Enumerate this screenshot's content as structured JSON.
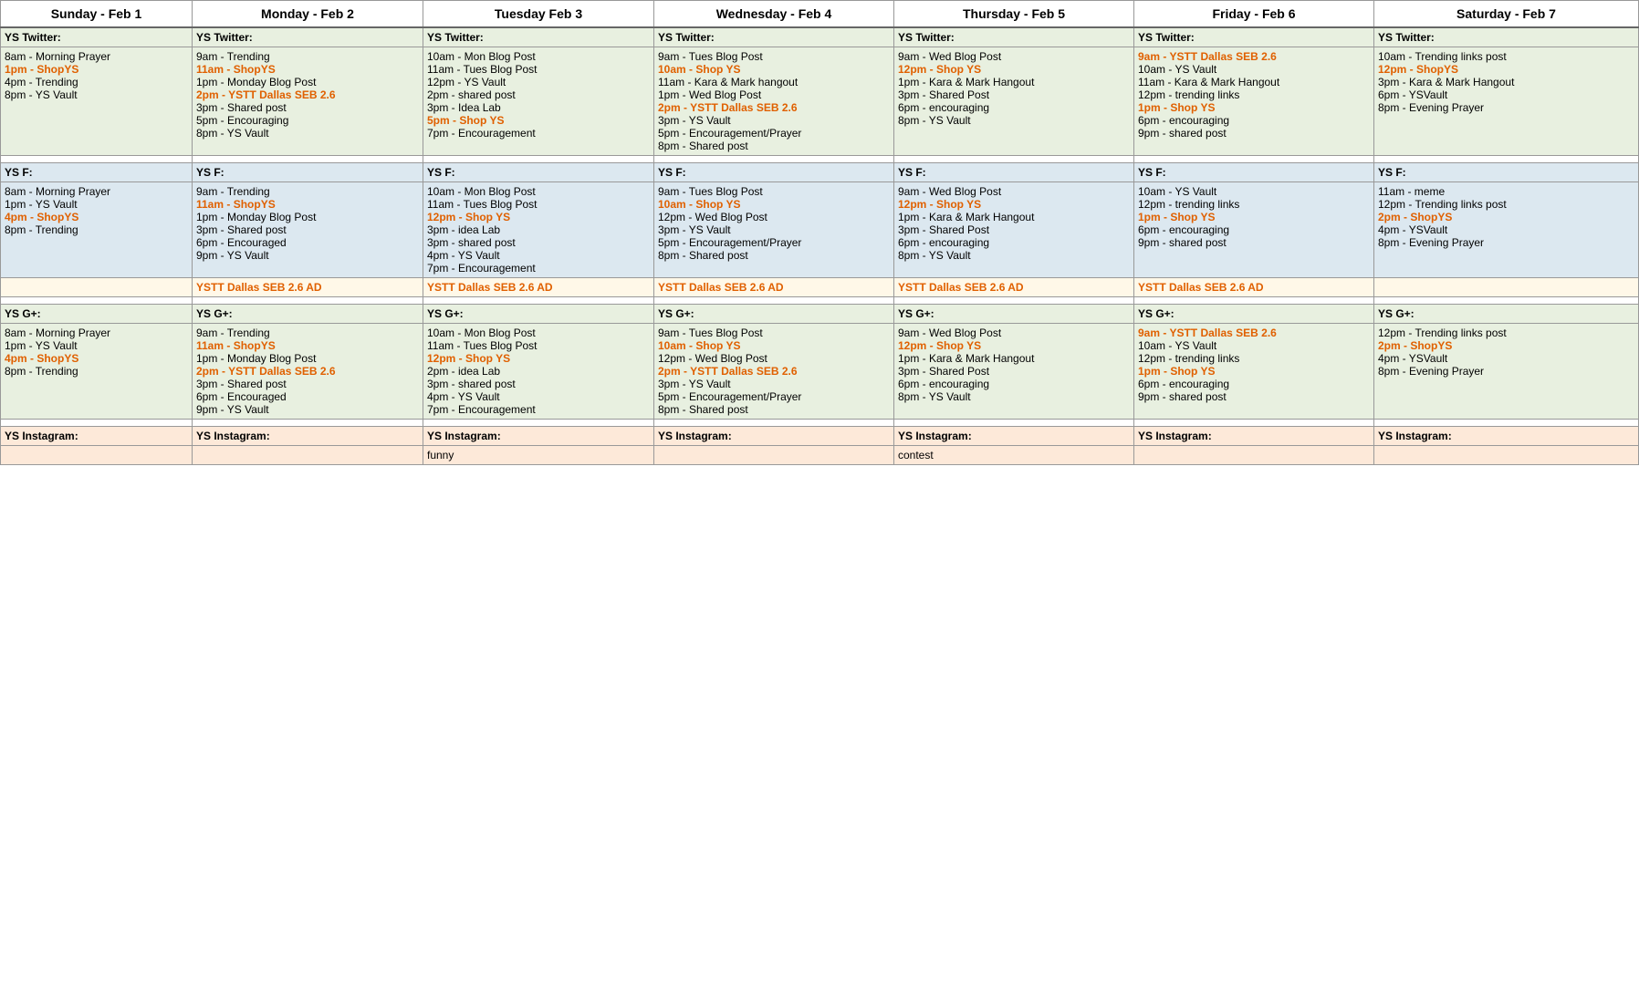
{
  "headers": [
    {
      "id": "sun",
      "label": "Sunday - Feb 1"
    },
    {
      "id": "mon",
      "label": "Monday - Feb 2"
    },
    {
      "id": "tue",
      "label": "Tuesday Feb 3"
    },
    {
      "id": "wed",
      "label": "Wednesday - Feb 4"
    },
    {
      "id": "thu",
      "label": "Thursday - Feb 5"
    },
    {
      "id": "fri",
      "label": "Friday - Feb 6"
    },
    {
      "id": "sat",
      "label": "Saturday - Feb 7"
    }
  ],
  "sections": {
    "twitter": {
      "label": "YS Twitter:",
      "sun": [
        {
          "text": "8am - Morning Prayer",
          "orange": false
        },
        {
          "text": "1pm - ShopYS",
          "orange": true
        },
        {
          "text": "4pm - Trending",
          "orange": false
        },
        {
          "text": "8pm - YS Vault",
          "orange": false
        }
      ],
      "mon": [
        {
          "text": "9am - Trending",
          "orange": false
        },
        {
          "text": "11am - ShopYS",
          "orange": true
        },
        {
          "text": "1pm - Monday Blog Post",
          "orange": false
        },
        {
          "text": "2pm - YSTT Dallas SEB 2.6",
          "orange": true
        },
        {
          "text": "3pm - Shared post",
          "orange": false
        },
        {
          "text": "5pm - Encouraging",
          "orange": false
        },
        {
          "text": "8pm - YS Vault",
          "orange": false
        }
      ],
      "tue": [
        {
          "text": "10am - Mon Blog Post",
          "orange": false
        },
        {
          "text": "11am - Tues Blog Post",
          "orange": false
        },
        {
          "text": "12pm - YS Vault",
          "orange": false
        },
        {
          "text": "2pm - shared post",
          "orange": false
        },
        {
          "text": "3pm - Idea Lab",
          "orange": false
        },
        {
          "text": "5pm - Shop YS",
          "orange": true
        },
        {
          "text": "7pm - Encouragement",
          "orange": false
        }
      ],
      "wed": [
        {
          "text": "9am - Tues Blog Post",
          "orange": false
        },
        {
          "text": "10am - Shop YS",
          "orange": true
        },
        {
          "text": "11am - Kara & Mark hangout",
          "orange": false
        },
        {
          "text": "1pm - Wed Blog Post",
          "orange": false
        },
        {
          "text": "2pm - YSTT Dallas SEB 2.6",
          "orange": true
        },
        {
          "text": "3pm - YS Vault",
          "orange": false
        },
        {
          "text": "5pm - Encouragement/Prayer",
          "orange": false
        },
        {
          "text": "8pm - Shared post",
          "orange": false
        }
      ],
      "thu": [
        {
          "text": "9am - Wed Blog Post",
          "orange": false
        },
        {
          "text": "12pm - Shop YS",
          "orange": true
        },
        {
          "text": "1pm - Kara & Mark Hangout",
          "orange": false
        },
        {
          "text": "3pm - Shared Post",
          "orange": false
        },
        {
          "text": "6pm - encouraging",
          "orange": false
        },
        {
          "text": "8pm - YS Vault",
          "orange": false
        }
      ],
      "fri": [
        {
          "text": "9am - YSTT Dallas SEB 2.6",
          "orange": true
        },
        {
          "text": "10am - YS Vault",
          "orange": false
        },
        {
          "text": "11am - Kara & Mark Hangout",
          "orange": false
        },
        {
          "text": "12pm - trending links",
          "orange": false
        },
        {
          "text": "1pm - Shop YS",
          "orange": true
        },
        {
          "text": "6pm - encouraging",
          "orange": false
        },
        {
          "text": "9pm - shared post",
          "orange": false
        }
      ],
      "sat": [
        {
          "text": "10am - Trending links post",
          "orange": false
        },
        {
          "text": "12pm - ShopYS",
          "orange": true
        },
        {
          "text": "3pm - Kara & Mark Hangout",
          "orange": false
        },
        {
          "text": "6pm - YSVault",
          "orange": false
        },
        {
          "text": "8pm - Evening Prayer",
          "orange": false
        }
      ]
    },
    "ysf": {
      "label": "YS F:",
      "sun": [
        {
          "text": "8am - Morning Prayer",
          "orange": false
        },
        {
          "text": "1pm - YS Vault",
          "orange": false
        },
        {
          "text": "4pm - ShopYS",
          "orange": true
        },
        {
          "text": "8pm - Trending",
          "orange": false
        }
      ],
      "mon": [
        {
          "text": "9am - Trending",
          "orange": false
        },
        {
          "text": "11am - ShopYS",
          "orange": true
        },
        {
          "text": "1pm - Monday Blog Post",
          "orange": false
        },
        {
          "text": "3pm - Shared post",
          "orange": false
        },
        {
          "text": "6pm - Encouraged",
          "orange": false
        },
        {
          "text": "9pm - YS Vault",
          "orange": false
        }
      ],
      "tue": [
        {
          "text": "10am - Mon Blog Post",
          "orange": false
        },
        {
          "text": "11am - Tues Blog Post",
          "orange": false
        },
        {
          "text": "12pm - Shop YS",
          "orange": true
        },
        {
          "text": "3pm - idea Lab",
          "orange": false
        },
        {
          "text": "3pm - shared post",
          "orange": false
        },
        {
          "text": "4pm - YS Vault",
          "orange": false
        },
        {
          "text": "7pm - Encouragement",
          "orange": false
        }
      ],
      "wed": [
        {
          "text": "9am - Tues Blog Post",
          "orange": false
        },
        {
          "text": "10am - Shop YS",
          "orange": true
        },
        {
          "text": "12pm - Wed Blog Post",
          "orange": false
        },
        {
          "text": "3pm - YS Vault",
          "orange": false
        },
        {
          "text": "5pm - Encouragement/Prayer",
          "orange": false
        },
        {
          "text": "8pm - Shared post",
          "orange": false
        }
      ],
      "thu": [
        {
          "text": "9am - Wed Blog Post",
          "orange": false
        },
        {
          "text": "12pm - Shop YS",
          "orange": true
        },
        {
          "text": "1pm - Kara & Mark Hangout",
          "orange": false
        },
        {
          "text": "3pm - Shared Post",
          "orange": false
        },
        {
          "text": "6pm - encouraging",
          "orange": false
        },
        {
          "text": "8pm - YS Vault",
          "orange": false
        }
      ],
      "fri": [
        {
          "text": "10am - YS Vault",
          "orange": false
        },
        {
          "text": "12pm - trending links",
          "orange": false
        },
        {
          "text": "1pm - Shop YS",
          "orange": true
        },
        {
          "text": "6pm - encouraging",
          "orange": false
        },
        {
          "text": "9pm - shared post",
          "orange": false
        }
      ],
      "sat": [
        {
          "text": "11am - meme",
          "orange": false
        },
        {
          "text": "12pm - Trending links post",
          "orange": false
        },
        {
          "text": "2pm - ShopYS",
          "orange": true
        },
        {
          "text": "4pm - YSVault",
          "orange": false
        },
        {
          "text": "8pm - Evening Prayer",
          "orange": false
        }
      ]
    },
    "ad": {
      "label": "YSTT Dallas SEB 2.6 AD",
      "mon": "YSTT Dallas SEB 2.6 AD",
      "tue": "YSTT Dallas SEB 2.6 AD",
      "wed": "YSTT Dallas SEB 2.6 AD",
      "thu": "YSTT Dallas SEB 2.6 AD",
      "fri": "YSTT Dallas SEB 2.6 AD"
    },
    "ysgplus": {
      "label": "YS G+:",
      "sun": [
        {
          "text": "8am - Morning Prayer",
          "orange": false
        },
        {
          "text": "1pm - YS Vault",
          "orange": false
        },
        {
          "text": "4pm - ShopYS",
          "orange": true
        },
        {
          "text": "8pm - Trending",
          "orange": false
        }
      ],
      "mon": [
        {
          "text": "9am - Trending",
          "orange": false
        },
        {
          "text": "11am - ShopYS",
          "orange": true
        },
        {
          "text": "1pm - Monday Blog Post",
          "orange": false
        },
        {
          "text": "2pm - YSTT Dallas SEB 2.6",
          "orange": true
        },
        {
          "text": "3pm - Shared post",
          "orange": false
        },
        {
          "text": "6pm - Encouraged",
          "orange": false
        },
        {
          "text": "9pm - YS Vault",
          "orange": false
        }
      ],
      "tue": [
        {
          "text": "10am - Mon Blog Post",
          "orange": false
        },
        {
          "text": "11am - Tues Blog Post",
          "orange": false
        },
        {
          "text": "12pm - Shop YS",
          "orange": true
        },
        {
          "text": "2pm - idea Lab",
          "orange": false
        },
        {
          "text": "3pm - shared post",
          "orange": false
        },
        {
          "text": "4pm - YS Vault",
          "orange": false
        },
        {
          "text": "7pm - Encouragement",
          "orange": false
        }
      ],
      "wed": [
        {
          "text": "9am - Tues Blog Post",
          "orange": false
        },
        {
          "text": "10am - Shop YS",
          "orange": true
        },
        {
          "text": "12pm - Wed Blog Post",
          "orange": false
        },
        {
          "text": "2pm - YSTT Dallas SEB 2.6",
          "orange": true
        },
        {
          "text": "3pm - YS Vault",
          "orange": false
        },
        {
          "text": "5pm - Encouragement/Prayer",
          "orange": false
        },
        {
          "text": "8pm - Shared post",
          "orange": false
        }
      ],
      "thu": [
        {
          "text": "9am - Wed Blog Post",
          "orange": false
        },
        {
          "text": "12pm - Shop YS",
          "orange": true
        },
        {
          "text": "1pm - Kara & Mark Hangout",
          "orange": false
        },
        {
          "text": "3pm - Shared Post",
          "orange": false
        },
        {
          "text": "6pm - encouraging",
          "orange": false
        },
        {
          "text": "8pm - YS Vault",
          "orange": false
        }
      ],
      "fri": [
        {
          "text": "9am - YSTT Dallas SEB 2.6",
          "orange": true
        },
        {
          "text": "10am - YS Vault",
          "orange": false
        },
        {
          "text": "12pm - trending links",
          "orange": false
        },
        {
          "text": "1pm - Shop YS",
          "orange": true
        },
        {
          "text": "6pm - encouraging",
          "orange": false
        },
        {
          "text": "9pm - shared post",
          "orange": false
        }
      ],
      "sat": [
        {
          "text": "12pm - Trending links post",
          "orange": false
        },
        {
          "text": "2pm - ShopYS",
          "orange": true
        },
        {
          "text": "4pm - YSVault",
          "orange": false
        },
        {
          "text": "8pm - Evening Prayer",
          "orange": false
        }
      ]
    },
    "instagram": {
      "label": "YS Instagram:",
      "sun": [],
      "mon": [],
      "tue": [
        {
          "text": "funny",
          "orange": false
        }
      ],
      "wed": [],
      "thu": [
        {
          "text": "contest",
          "orange": false
        }
      ],
      "fri": [],
      "sat": []
    }
  }
}
